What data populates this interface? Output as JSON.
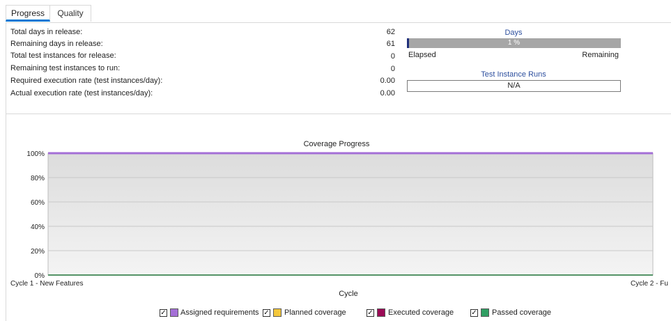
{
  "tabs": {
    "progress_label": "Progress",
    "quality_label": "Quality",
    "active": "Progress"
  },
  "summary": {
    "total_days_label": "Total days in release:",
    "total_days_value": "62",
    "remaining_days_label": "Remaining days in release:",
    "remaining_days_value": "61",
    "total_instances_label": "Total test instances for release:",
    "total_instances_value": "0",
    "remaining_instances_label": "Remaining test instances to run:",
    "remaining_instances_value": "0",
    "required_rate_label": "Required execution rate (test instances/day):",
    "required_rate_value": "0.00",
    "actual_rate_label": "Actual execution rate (test instances/day):",
    "actual_rate_value": "0.00"
  },
  "days_gauge": {
    "title": "Days",
    "elapsed_percent": 1,
    "percent_text": "1 %",
    "elapsed_label": "Elapsed",
    "remaining_label": "Remaining"
  },
  "runs_gauge": {
    "title": "Test Instance Runs",
    "value": "N/A"
  },
  "colors": {
    "accent": "#0078d4",
    "gauge_title": "#2d4f9e",
    "days_fill": "#1f2f7a",
    "days_track": "#a6a6a6"
  },
  "chart_data": {
    "type": "line",
    "title": "Coverage Progress",
    "xlabel": "Cycle",
    "ylabel": "",
    "categories": [
      "Cycle 1 - New Features",
      "Cycle 2 - Fu"
    ],
    "ylim": [
      0,
      100
    ],
    "y_ticks": [
      "0%",
      "20%",
      "40%",
      "60%",
      "80%",
      "100%"
    ],
    "grid": true,
    "legend_position": "bottom",
    "series": [
      {
        "name": "Assigned requirements",
        "color": "#a46fd6",
        "values": [
          100,
          100
        ],
        "checked": true
      },
      {
        "name": "Planned coverage",
        "color": "#f3c73b",
        "values": [
          0,
          0
        ],
        "checked": true
      },
      {
        "name": "Executed coverage",
        "color": "#9a0a55",
        "values": [
          0,
          0
        ],
        "checked": true
      },
      {
        "name": "Passed coverage",
        "color": "#2f9e62",
        "values": [
          0,
          0
        ],
        "checked": true
      }
    ]
  }
}
